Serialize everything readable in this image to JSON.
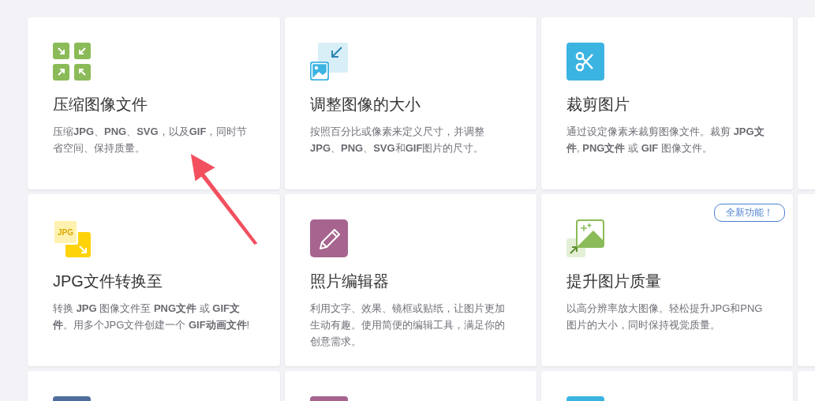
{
  "rows": [
    {
      "cards": [
        {
          "kind": "compress",
          "title": "压缩图像文件",
          "description": "压缩**JPG**、**PNG**、**SVG**，以及**GIF**，同时节省空间、保持质量。"
        },
        {
          "kind": "resize",
          "title": "调整图像的大小",
          "description": "按照百分比或像素来定义尺寸，并调整**JPG**、**PNG**、**SVG**和**GIF**图片的尺寸。"
        },
        {
          "kind": "crop",
          "title": "裁剪图片",
          "description": "通过设定像素来裁剪图像文件。裁剪 **JPG文件**, **PNG文件** 或 **GIF** 图像文件。"
        }
      ]
    },
    {
      "cards": [
        {
          "kind": "convert",
          "icon_label": "JPG",
          "title": "JPG文件转换至",
          "description": "转换 **JPG** 图像文件至 **PNG文件** 或 **GIF文件**。用多个JPG文件创建一个 **GIF动画文件**!"
        },
        {
          "kind": "edit",
          "title": "照片编辑器",
          "description": "利用文字、效果、镜框或贴纸，让图片更加生动有趣。使用简便的编辑工具，满足你的创意需求。"
        },
        {
          "kind": "upscale",
          "badge": "全新功能！",
          "title": "提升图片质量",
          "description": "以高分辨率放大图像。轻松提升JPG和PNG图片的大小，同时保持视觉质量。"
        }
      ]
    },
    {
      "cards": [
        {
          "kind": "plain",
          "color": "#4f6e9e"
        },
        {
          "kind": "plain",
          "color": "#a7648f"
        },
        {
          "kind": "plain",
          "color": "#3cb4e2"
        }
      ]
    }
  ]
}
